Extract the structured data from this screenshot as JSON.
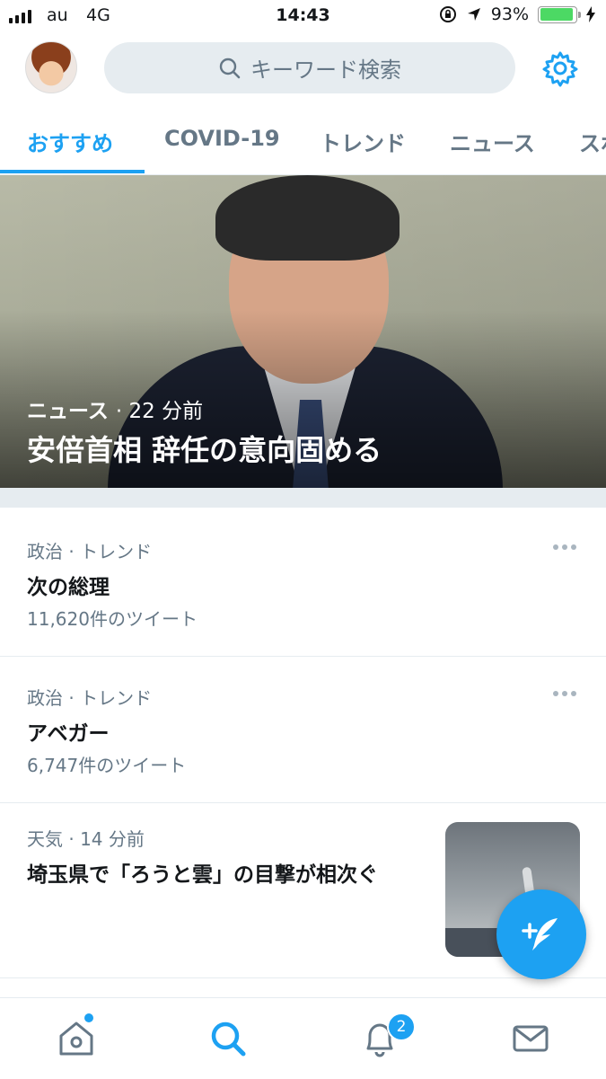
{
  "status_bar": {
    "carrier": "au",
    "network": "4G",
    "time": "14:43",
    "battery": "93%",
    "battery_level": 0.93
  },
  "header": {
    "search_placeholder": "キーワード検索",
    "icons": [
      "avatar",
      "search-icon",
      "gear-icon"
    ]
  },
  "tabs": [
    {
      "label": "おすすめ",
      "active": true
    },
    {
      "label": "COVID-19",
      "active": false
    },
    {
      "label": "トレンド",
      "active": false
    },
    {
      "label": "ニュース",
      "active": false
    },
    {
      "label": "スポ",
      "active": false
    }
  ],
  "hero": {
    "category": "ニュース",
    "time": "22 分前",
    "title": "安倍首相 辞任の意向固める"
  },
  "trends": [
    {
      "category": "政治 · トレンド",
      "name": "次の総理",
      "count": "11,620件のツイート"
    },
    {
      "category": "政治 · トレンド",
      "name": "アベガー",
      "count": "6,747件のツイート"
    }
  ],
  "news_item": {
    "category": "天気",
    "time": "14 分前",
    "title": "埼玉県で「ろうと雲」の目撃が相次ぐ"
  },
  "bottom_nav": {
    "items": [
      "home-icon",
      "search-icon",
      "bell-icon",
      "mail-icon"
    ],
    "notification_badge": "2"
  },
  "colors": {
    "accent": "#1da1f2",
    "muted": "#657786",
    "divider": "#e6ecf0"
  }
}
